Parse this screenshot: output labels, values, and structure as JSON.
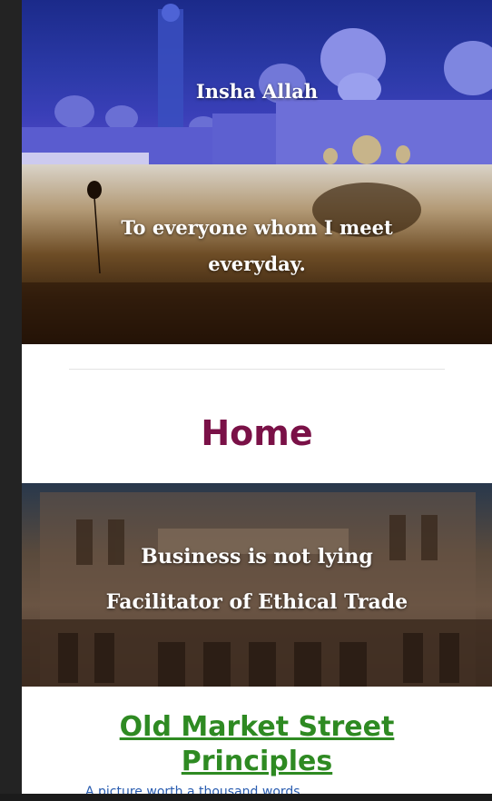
{
  "banners": {
    "mosque_text": "Insha Allah",
    "field_text": "To everyone whom I meet everyday.",
    "building_line1": "Business is not lying",
    "building_line2": "Facilitator of Ethical Trade"
  },
  "home": {
    "title": "Home"
  },
  "principles": {
    "title": "Old Market Street Principles",
    "subtitle_partial": "A picture worth a thousand words"
  },
  "colors": {
    "home_title": "#7a1147",
    "principles_link": "#2e8a22",
    "subtitle_link": "#2a5db0"
  }
}
